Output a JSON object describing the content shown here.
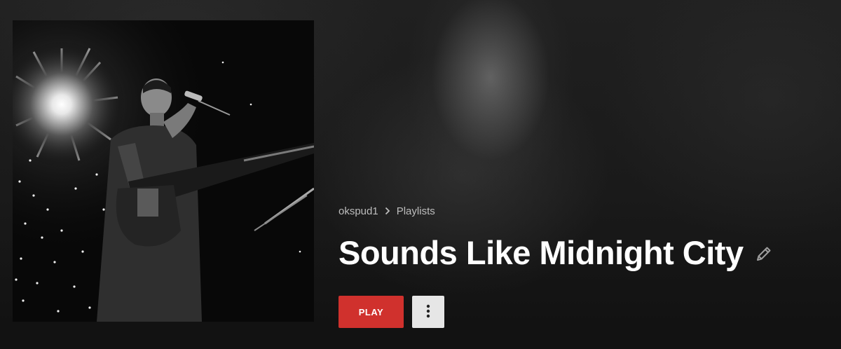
{
  "breadcrumb": {
    "user": "okspud1",
    "section": "Playlists"
  },
  "playlist": {
    "title": "Sounds Like Midnight City"
  },
  "actions": {
    "play_label": "PLAY"
  },
  "icons": {
    "breadcrumb_separator": "chevron-right-icon",
    "edit": "pencil-icon",
    "more": "more-vertical-icon"
  },
  "colors": {
    "play_button": "#d0312d",
    "more_button": "#e6e6e6",
    "title_text": "#ffffff",
    "breadcrumb_text": "#bdbdbd"
  }
}
